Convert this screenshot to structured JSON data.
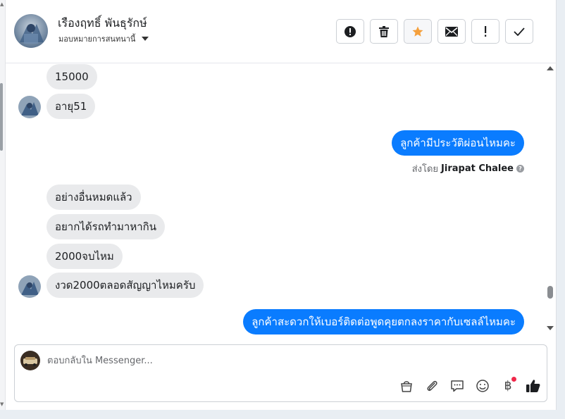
{
  "header": {
    "name": "เรืองฤทธิ์ พันธุรักษ์",
    "assign_label": "มอบหมายการสนทนานี้",
    "actions": [
      {
        "icon": "alert-circle-icon",
        "label": "spam"
      },
      {
        "icon": "trash-icon",
        "label": "delete"
      },
      {
        "icon": "star-icon",
        "label": "star"
      },
      {
        "icon": "envelope-icon",
        "label": "mark-unread"
      },
      {
        "icon": "exclamation-icon",
        "label": "follow-up"
      },
      {
        "icon": "check-icon",
        "label": "done"
      }
    ]
  },
  "colors": {
    "outgoing": "#0a7cff",
    "incoming": "#e9eaec",
    "star": "#f5a03c"
  },
  "messages": {
    "in_1": "15000",
    "in_2": "อายุ51",
    "out_1": "ลูกค้ามีประวัติผ่อนไหมคะ",
    "sent_by_prefix": "ส่งโดย",
    "sent_by_name": "Jirapat Chalee",
    "in_3": "อย่างอื่นหมดแล้ว",
    "in_4": "อยากได้รถทำมาหากิน",
    "in_5": "2000จบไหม",
    "in_6": "งวด2000ตลอดสัญญาไหมครับ",
    "out_2": "ลูกค้าสะดวกให้เบอร์ติดต่อพูดคุยตกลงราคากับเซลล์ไหมคะ"
  },
  "composer": {
    "placeholder": "ตอบกลับใน Messenger...",
    "baht_symbol": "฿",
    "tools": [
      "bag-icon",
      "paperclip-icon",
      "saved-reply-icon",
      "emoji-icon",
      "baht-icon",
      "thumbs-up-icon"
    ]
  }
}
